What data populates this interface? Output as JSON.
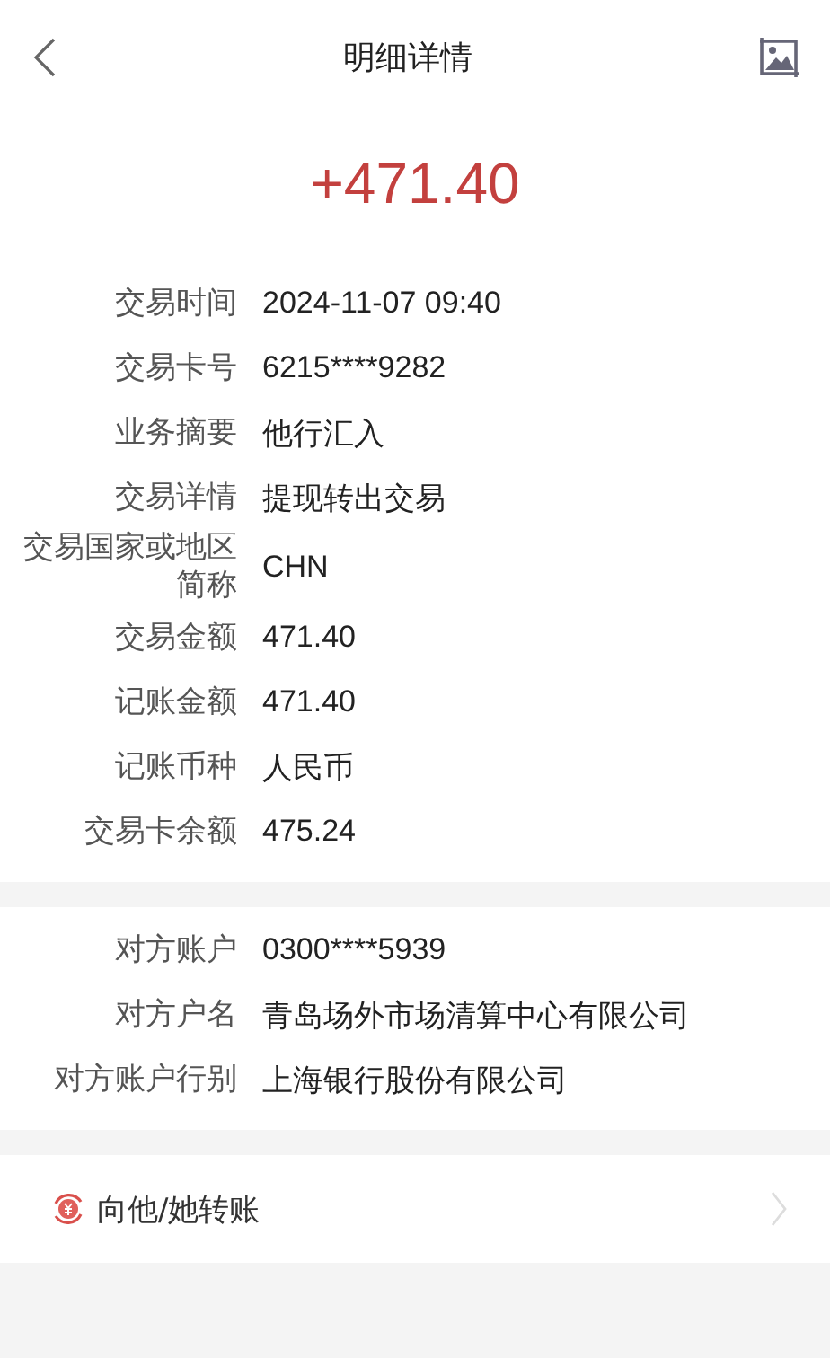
{
  "header": {
    "title": "明细详情"
  },
  "amount": "+471.40",
  "sections": [
    {
      "rows": [
        {
          "label": "交易时间",
          "value": "2024-11-07 09:40"
        },
        {
          "label": "交易卡号",
          "value": "6215****9282"
        },
        {
          "label": "业务摘要",
          "value": "他行汇入"
        },
        {
          "label": "交易详情",
          "value": "提现转出交易"
        },
        {
          "label": "交易国家或地区简称",
          "value": "CHN"
        },
        {
          "label": "交易金额",
          "value": "471.40"
        },
        {
          "label": "记账金额",
          "value": "471.40"
        },
        {
          "label": "记账币种",
          "value": "人民币"
        },
        {
          "label": "交易卡余额",
          "value": "475.24"
        }
      ]
    },
    {
      "rows": [
        {
          "label": "对方账户",
          "value": "0300****5939"
        },
        {
          "label": "对方户名",
          "value": "青岛场外市场清算中心有限公司"
        },
        {
          "label": "对方账户行别",
          "value": "上海银行股份有限公司"
        }
      ]
    }
  ],
  "action": {
    "label": "向他/她转账"
  }
}
